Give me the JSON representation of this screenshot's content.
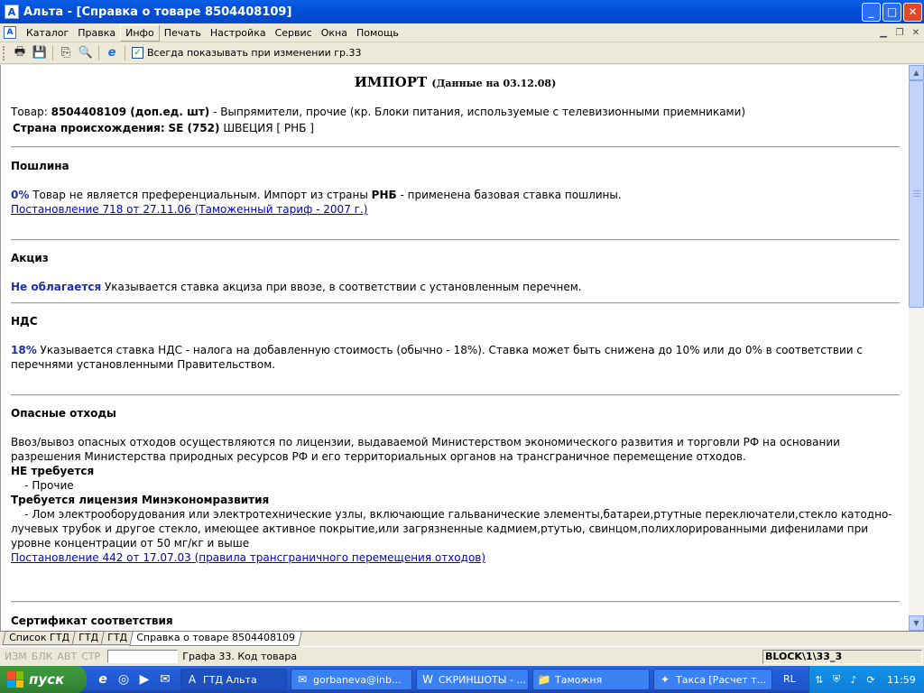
{
  "window": {
    "title": "Альта - [Справка о товаре 8504408109]",
    "minimize": "_",
    "maximize": "□",
    "close": "✕"
  },
  "menu": {
    "items": [
      "Каталог",
      "Правка",
      "Инфо",
      "Печать",
      "Настройка",
      "Сервис",
      "Окна",
      "Помощь"
    ],
    "active_index": 2
  },
  "toolbar": {
    "checkbox_label": "Всегда показывать при изменении гр.33",
    "checkbox_checked": true
  },
  "doc": {
    "heading": "ИМПОРТ",
    "heading_date": "(Данные на 03.12.08)",
    "goods_label": "Товар:",
    "goods_code": "8504408109 (доп.ед. шт)",
    "goods_desc": " - Выпрямители, прочие (кр. Блоки питания, используемые с телевизионными приемниками)",
    "origin_label": "Страна происхождения:",
    "origin_code": "SE (752)",
    "origin_name": " ШВЕЦИЯ [ РНБ ]",
    "duty": {
      "title": "Пошлина",
      "rate": "0%",
      "text_a": "  Товар не является преференциальным. Импорт из страны ",
      "text_country": "РНБ",
      "text_b": " - применена базовая ставка пошлины.",
      "link": "Постановление 718 от 27.11.06 (Таможенный тариф - 2007 г.)"
    },
    "excise": {
      "title": "Акциз",
      "rate": "Не облагается",
      "text": "  Указывается ставка акциза при ввозе, в соответствии с установленным перечнем."
    },
    "vat": {
      "title": "НДС",
      "rate": "18%",
      "text": "  Указывается ставка НДС - налога на добавленную стоимость (обычно - 18%). Ставка может быть снижена до 10% или до 0% в соответствии с перечнями установленными Правительством."
    },
    "waste": {
      "title": "Опасные отходы",
      "intro": "Ввоз/вывоз опасных отходов осуществляются по лицензии, выдаваемой Министерством экономического развития и торговли РФ на основании разрешения Министерства природных ресурсов РФ и его территориальных органов на трансграничное перемещение отходов.",
      "not_required": "НЕ требуется",
      "other": "    - Прочие",
      "license": "Требуется лицензия Минэкономразвития",
      "license_item": "    - Лом электрооборудования или электротехнические узлы, включающие гальванические элементы,батареи,ртутные переключатели,стекло катодно-лучевых трубок и другое стекло, имеющее активное покрытие,или загрязненные кадмием,ртутью, свинцом,полихлорированными дифенилами при уровне концентрации от 50 мг/кг и выше",
      "link": "Постановление 442 от 17.07.03 (правила трансграничного перемещения отходов)"
    },
    "cert": {
      "title": "Сертификат соответствия"
    }
  },
  "tabs": [
    "Список ГТД",
    "ГТД",
    "ГТД",
    "Справка о товаре 8504408109"
  ],
  "active_tab": 3,
  "status": {
    "indicators": [
      "ИЗМ",
      "БЛК",
      "АВТ",
      "СТР"
    ],
    "field_label": "Графа 33. Код товара",
    "block": "BLOCK\\1\\33_3"
  },
  "taskbar": {
    "start": "пуск",
    "tasks": [
      "ГТД Альта",
      "gorbaneva@inb...",
      "СКРИНШОТЫ - ...",
      "Таможня",
      "Такса [Расчет т..."
    ],
    "lang": "RL",
    "clock": "11:59"
  }
}
